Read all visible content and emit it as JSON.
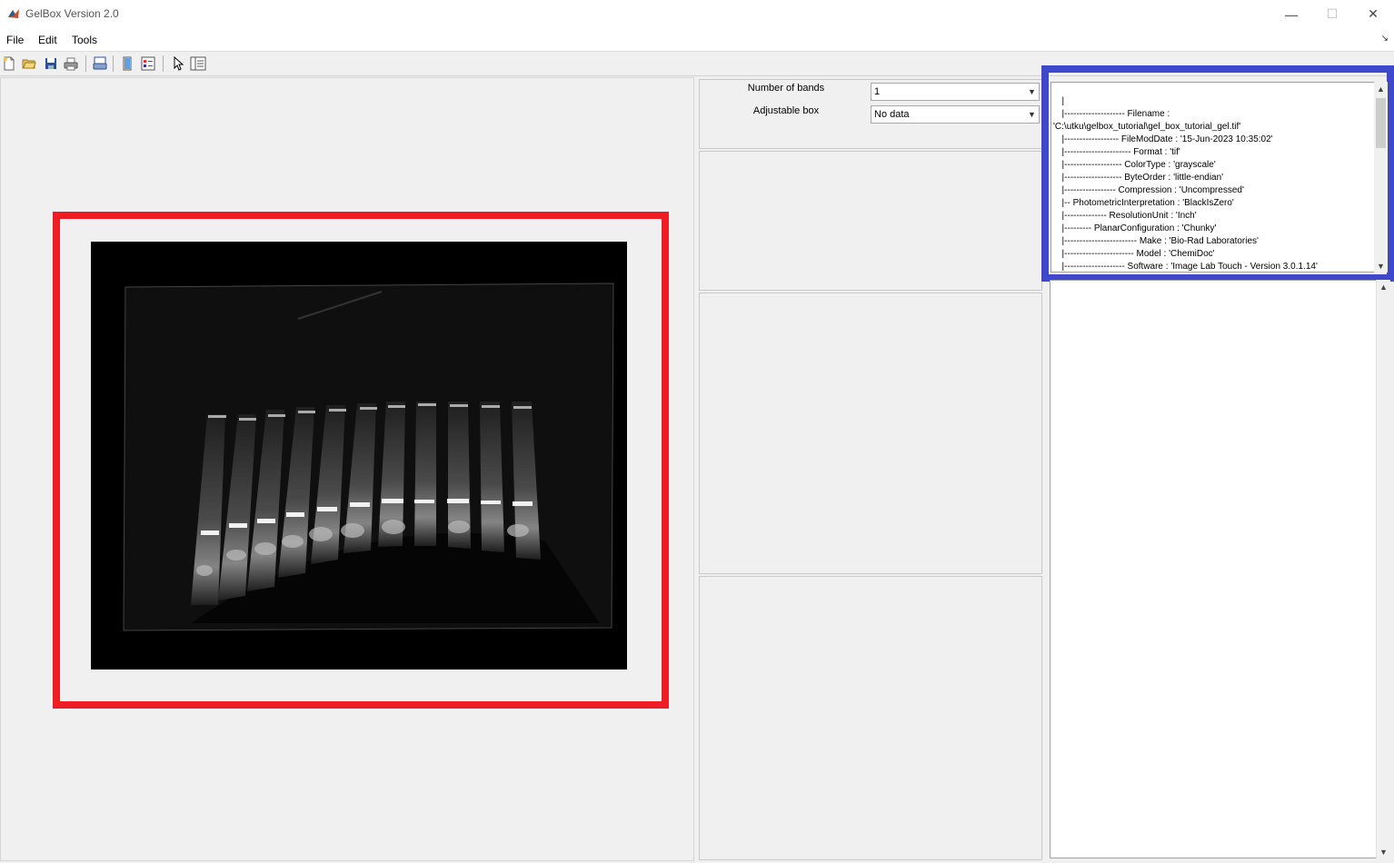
{
  "window": {
    "title": "GelBox Version 2.0",
    "controls": [
      "—",
      "☐",
      "✕"
    ]
  },
  "menu": {
    "items": [
      "File",
      "Edit",
      "Tools"
    ],
    "expand_glyph": "↘"
  },
  "toolbar": {
    "icons": [
      "new-file-icon",
      "open-folder-icon",
      "save-icon",
      "print-icon",
      "print-preview-icon",
      "colorbar-icon",
      "legend-icon",
      "pointer-icon",
      "property-inspector-icon"
    ]
  },
  "controls": {
    "bands_label": "Number of bands",
    "bands_value": "1",
    "box_label": "Adjustable box",
    "box_value": "No data"
  },
  "image_info": {
    "lines": [
      "  |",
      "  |-------------------- Filename :",
      "'C:\\utku\\gelbox_tutorial\\gel_box_tutorial_gel.tif'",
      "  |------------------ FileModDate : '15-Jun-2023 10:35:02'",
      "  |---------------------- Format : 'tif'",
      "  |------------------- ColorType : 'grayscale'",
      "  |------------------- ByteOrder : 'little-endian'",
      "  |----------------- Compression : 'Uncompressed'",
      "  |-- PhotometricInterpretation : 'BlackIsZero'",
      "  |-------------- ResolutionUnit : 'Inch'",
      "  |--------- PlanarConfiguration : 'Chunky'",
      "  |------------------------ Make : 'Bio-Rad Laboratories'",
      "  |----------------------- Model : 'ChemiDoc'",
      "  |-------------------- Software : 'Image Lab Touch - Version 3.0.1.14'"
    ]
  },
  "colors": {
    "highlight_red": "#ee1c25",
    "highlight_blue": "#3e48cc"
  }
}
